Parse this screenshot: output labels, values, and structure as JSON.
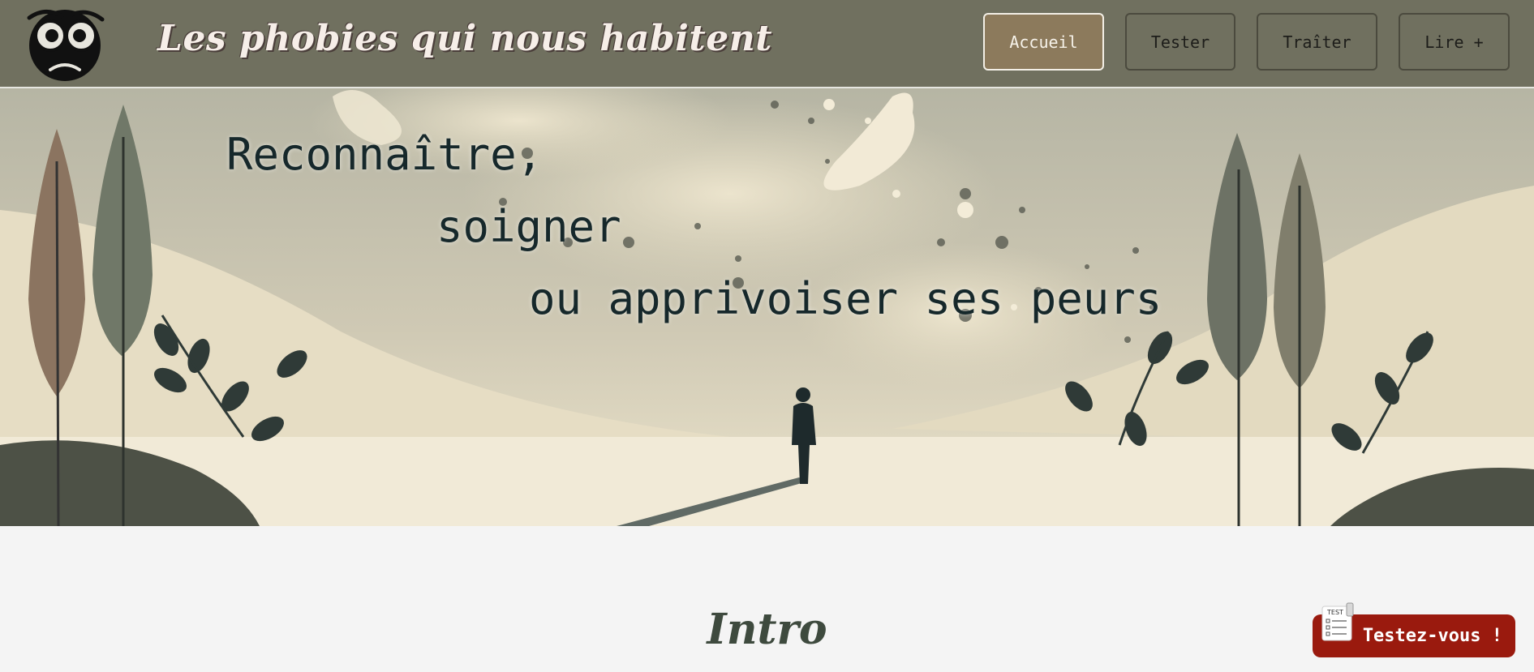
{
  "header": {
    "title": "Les phobies qui nous habitent",
    "logo_icon": "worried-face-icon",
    "nav": [
      {
        "label": "Accueil",
        "active": true
      },
      {
        "label": "Tester",
        "active": false
      },
      {
        "label": "Traîter",
        "active": false
      },
      {
        "label": "Lire +",
        "active": false
      }
    ]
  },
  "hero": {
    "lines": [
      "Reconnaître,",
      "soigner",
      "ou apprivoiser ses peurs"
    ],
    "image": "landscape-with-lone-figure"
  },
  "intro": {
    "heading": "Intro"
  },
  "cta": {
    "label": "Testez-vous !",
    "icon_label": "TEST",
    "icon": "test-sheet-icon"
  },
  "colors": {
    "header_bg": "#70705f",
    "active_button": "#8c7a5c",
    "cta_bg": "#9a1a0e",
    "page_bg": "#f4f4f4"
  }
}
